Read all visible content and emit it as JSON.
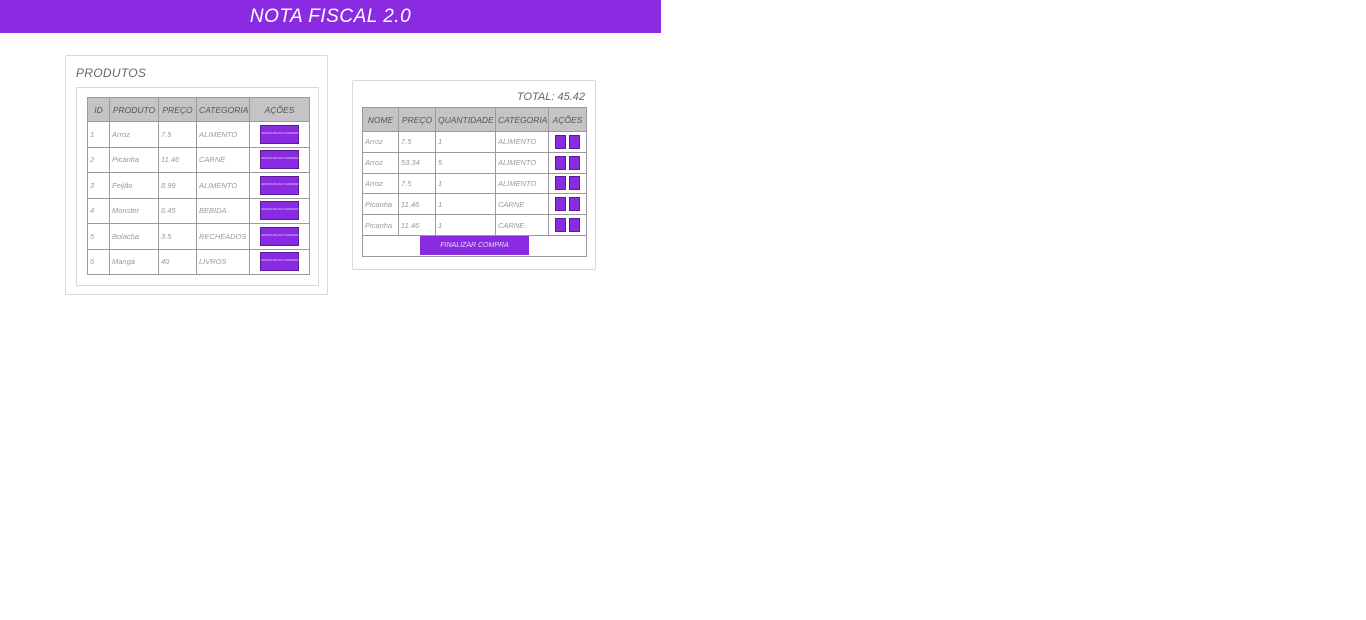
{
  "app": {
    "title": "NOTA FISCAL 2.0"
  },
  "colors": {
    "accent": "#8a2be2",
    "header_bg": "#c4c4c4"
  },
  "produtos": {
    "title": "PRODUTOS",
    "columns": [
      "ID",
      "PRODUTO",
      "PREÇO",
      "CATEGORIA",
      "AÇÕES"
    ],
    "rows": [
      {
        "id": "1",
        "produto": "Arroz",
        "preco": "7.5",
        "categoria": "ALIMENTO",
        "action": "ADICIONAR AO CARRINHO"
      },
      {
        "id": "2",
        "produto": "Picanha",
        "preco": "11.46",
        "categoria": "CARNE",
        "action": "ADICIONAR AO CARRINHO"
      },
      {
        "id": "3",
        "produto": "Feijão",
        "preco": "8.99",
        "categoria": "ALIMENTO",
        "action": "ADICIONAR AO CARRINHO"
      },
      {
        "id": "4",
        "produto": "Monster",
        "preco": "6.45",
        "categoria": "BEBIDA",
        "action": "ADICIONAR AO CARRINHO"
      },
      {
        "id": "5",
        "produto": "Bolacha",
        "preco": "3.5",
        "categoria": "RECHEADOS",
        "action": "ADICIONAR AO CARRINHO"
      },
      {
        "id": "6",
        "produto": "Mangá",
        "preco": "40",
        "categoria": "LIVROS",
        "action": "ADICIONAR AO CARRINHO"
      }
    ]
  },
  "carrinho": {
    "total": "TOTAL: 45.42",
    "columns": [
      "NOME",
      "PREÇO",
      "QUANTIDADE",
      "CATEGORIA",
      "AÇÕES"
    ],
    "rows": [
      {
        "nome": "Arroz",
        "preco": "7.5",
        "quantidade": "1",
        "categoria": "ALIMENTO"
      },
      {
        "nome": "Arroz",
        "preco": "53.34",
        "quantidade": "5",
        "categoria": "ALIMENTO"
      },
      {
        "nome": "Arroz",
        "preco": "7.5",
        "quantidade": "1",
        "categoria": "ALIMENTO"
      },
      {
        "nome": "Picanha",
        "preco": "11.46",
        "quantidade": "1",
        "categoria": "CARNE"
      },
      {
        "nome": "Picanha",
        "preco": "11.46",
        "quantidade": "1",
        "categoria": "CARNE"
      }
    ],
    "finish_label": "FINALIZAR COMPRA"
  }
}
